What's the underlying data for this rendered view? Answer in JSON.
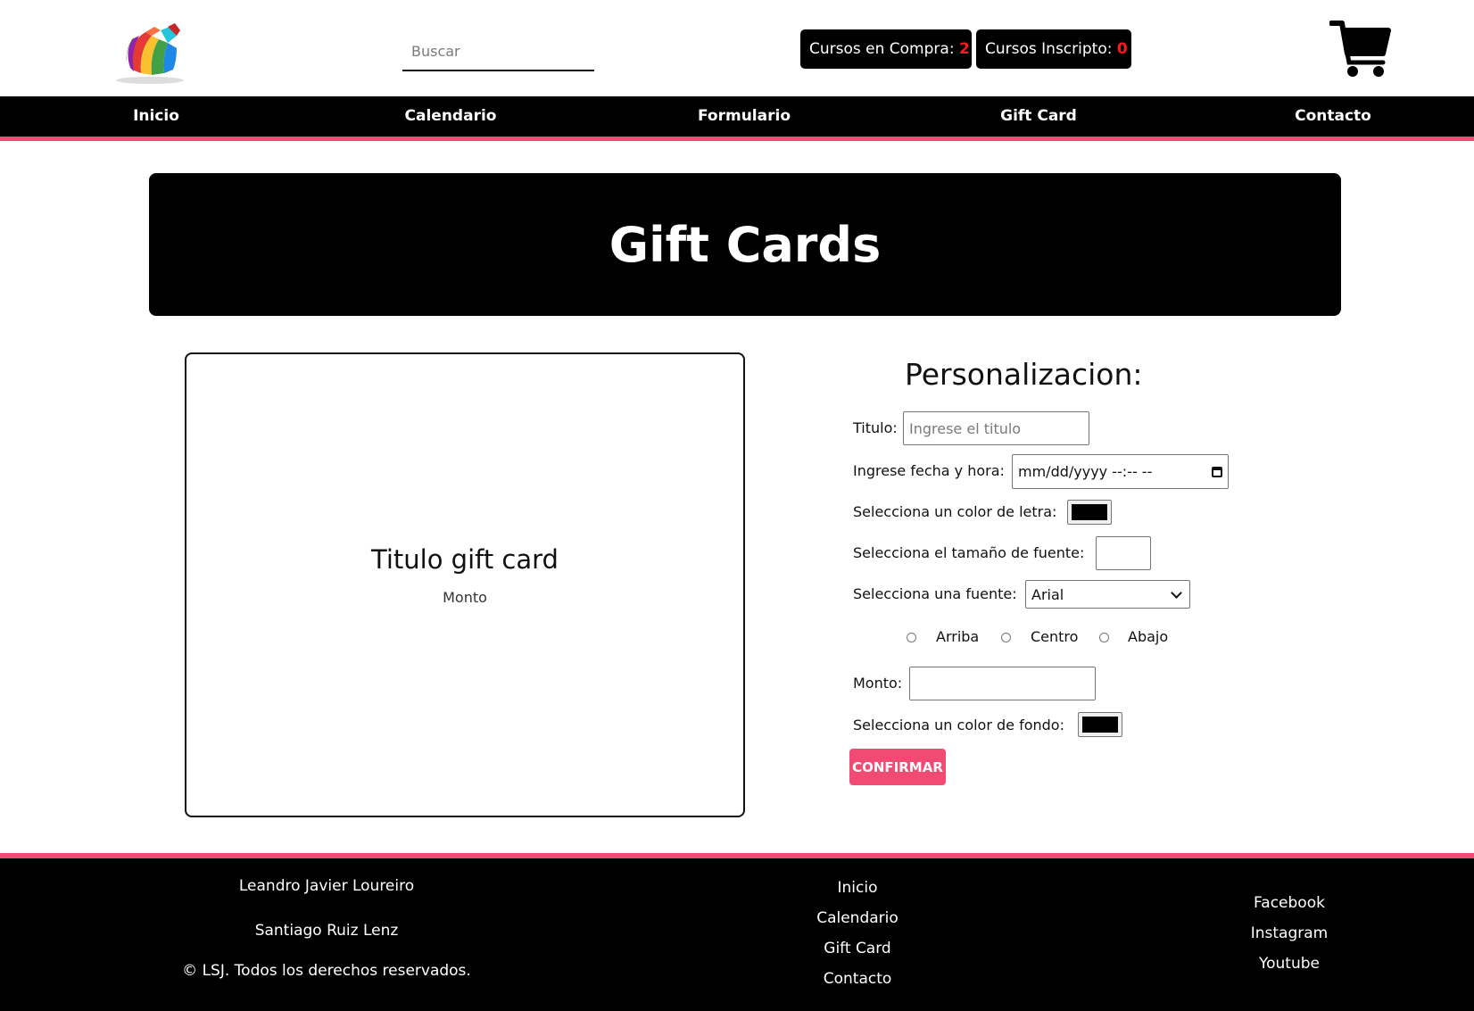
{
  "header": {
    "search": {
      "placeholder": "Buscar",
      "value": ""
    },
    "counters": {
      "compra_label": "Cursos en Compra:",
      "compra_count": "2",
      "inscripto_label": "Cursos Inscripto:",
      "inscripto_count": "0"
    },
    "cart_icon": "shopping-cart-icon",
    "logo_icon": "colorful-sphere-logo"
  },
  "nav": {
    "items": [
      {
        "label": "Inicio"
      },
      {
        "label": "Calendario"
      },
      {
        "label": "Formulario"
      },
      {
        "label": "Gift Card"
      },
      {
        "label": "Contacto"
      }
    ]
  },
  "banner": {
    "title": "Gift Cards"
  },
  "preview": {
    "title": "Titulo gift card",
    "amount": "Monto"
  },
  "form": {
    "title": "Personalizacion:",
    "titulo_label": "Titulo:",
    "titulo_placeholder": "Ingrese el titulo",
    "fecha_label": "Ingrese fecha y hora:",
    "fecha_value": "mm/dd/yyyy --:-- --",
    "color_letra_label": "Selecciona un color de letra:",
    "color_letra_value": "#000000",
    "tamano_label": "Selecciona el tamaño de fuente:",
    "tamano_value": "",
    "fuente_label": "Selecciona una fuente:",
    "fuente_value": "Arial",
    "positions": [
      "Arriba",
      "Centro",
      "Abajo"
    ],
    "monto_label": "Monto:",
    "monto_value": "",
    "color_fondo_label": "Selecciona un color de fondo:",
    "color_fondo_value": "#000000",
    "confirm_label": "CONFIRMAR"
  },
  "footer": {
    "authors": [
      "Leandro Javier Loureiro",
      "Santiago Ruiz Lenz"
    ],
    "copyright": "© LSJ. Todos los derechos reservados.",
    "links": [
      "Inicio",
      "Calendario",
      "Gift Card",
      "Contacto"
    ],
    "social": [
      "Facebook",
      "Instagram",
      "Youtube"
    ]
  },
  "colors": {
    "accent": "#f24b73",
    "counter_number": "#ff1a1a",
    "dark": "#000000"
  }
}
